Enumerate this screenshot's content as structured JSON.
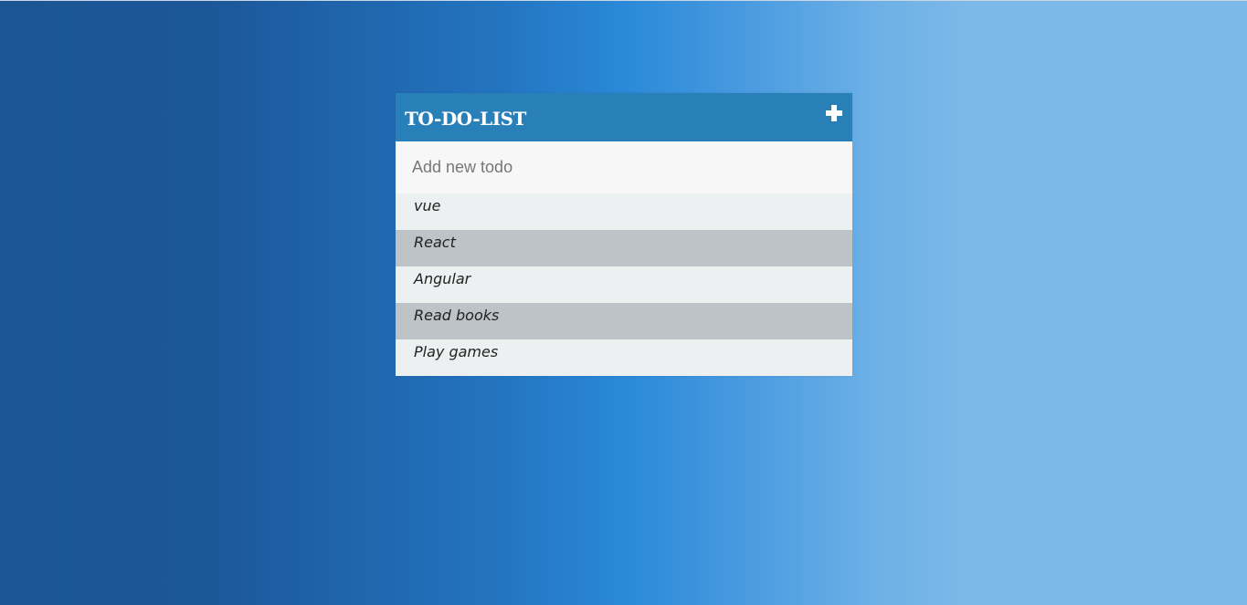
{
  "header": {
    "title": "TO-DO-LIST",
    "add_icon": "plus-icon"
  },
  "input": {
    "placeholder": "Add new todo",
    "value": ""
  },
  "todos": [
    {
      "label": "vue"
    },
    {
      "label": "React"
    },
    {
      "label": "Angular"
    },
    {
      "label": "Read books"
    },
    {
      "label": "Play games"
    }
  ],
  "colors": {
    "header_bg": "#2980b9",
    "input_bg": "#f7f7f7",
    "item_bg_light": "#ecf0f1",
    "item_bg_dark": "#bdc3c7",
    "background_left": "#1c5799",
    "background_right": "#7db9e8"
  }
}
